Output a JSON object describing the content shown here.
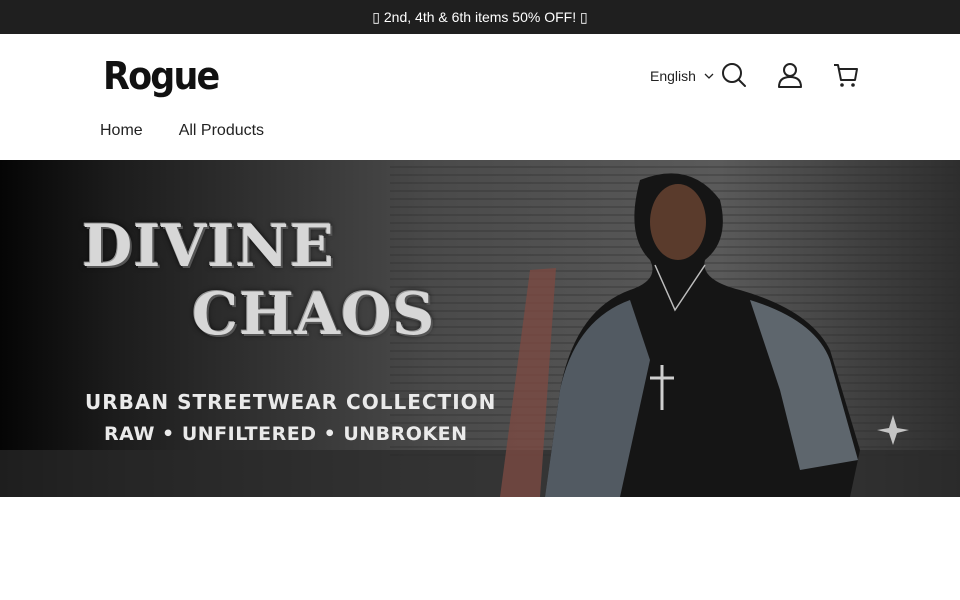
{
  "announcement": {
    "text": "▯ 2nd, 4th & 6th items 50% OFF! ▯"
  },
  "header": {
    "logo": "Rogue",
    "language": "English",
    "icons": [
      "chevron-down-icon",
      "search-icon",
      "user-icon",
      "cart-icon"
    ]
  },
  "nav": {
    "items": [
      "Home",
      "All Products"
    ]
  },
  "hero": {
    "title_line1": "DIVINE",
    "title_line2": "CHAOS",
    "subtitle": "URBAN STREETWEAR COLLECTION",
    "tagline": "RAW • UNFILTERED • UNBROKEN"
  },
  "colors": {
    "announcement_bg": "#1f1f1f",
    "announcement_text": "#ffffff",
    "page_bg": "#ffffff",
    "text": "#222222"
  }
}
